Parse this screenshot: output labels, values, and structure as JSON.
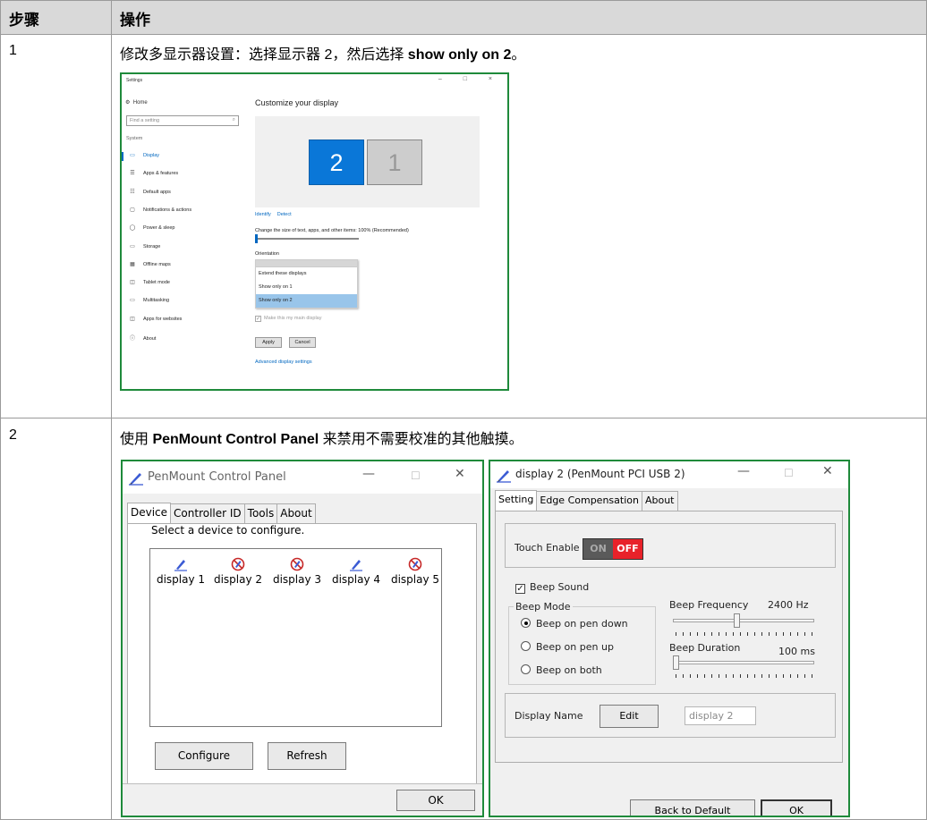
{
  "table": {
    "header": {
      "step_label": "步骤",
      "action_label": "操作"
    },
    "rows": [
      {
        "step": "1",
        "instruction_prefix": "修改多显示器设置：选择显示器 2，然后选择 ",
        "instruction_bold": "show only on 2",
        "instruction_suffix": "。"
      },
      {
        "step": "2",
        "instruction_prefix": "使用 ",
        "instruction_bold": "PenMount Control Panel",
        "instruction_suffix": " 来禁用不需要校准的其他触摸。"
      }
    ]
  },
  "settings_window": {
    "title": "Settings",
    "controls": "–  □  ×",
    "home": "Home",
    "search_placeholder": "Find a setting",
    "section": "System",
    "nav_items": [
      {
        "label": "Display",
        "icon": "monitor-icon"
      },
      {
        "label": "Apps & features",
        "icon": "list-icon"
      },
      {
        "label": "Default apps",
        "icon": "default-apps-icon"
      },
      {
        "label": "Notifications & actions",
        "icon": "notification-icon"
      },
      {
        "label": "Power & sleep",
        "icon": "power-icon"
      },
      {
        "label": "Storage",
        "icon": "storage-icon"
      },
      {
        "label": "Offline maps",
        "icon": "map-icon"
      },
      {
        "label": "Tablet mode",
        "icon": "tablet-icon"
      },
      {
        "label": "Multitasking",
        "icon": "multitasking-icon"
      },
      {
        "label": "Apps for websites",
        "icon": "web-apps-icon"
      },
      {
        "label": "About",
        "icon": "info-icon"
      }
    ],
    "heading": "Customize your display",
    "monitor_2": "2",
    "monitor_1": "1",
    "identify": "Identify",
    "detect": "Detect",
    "scale_text": "Change the size of text, apps, and other items: 100% (Recommended)",
    "orientation_label": "Orientation",
    "dropdown_options": [
      "Extend these displays",
      "Show only on 1",
      "Show only on 2"
    ],
    "main_display_check": "Make this my main display",
    "apply": "Apply",
    "cancel": "Cancel",
    "advanced": "Advanced display settings"
  },
  "penmount_panel": {
    "title": "PenMount Control Panel",
    "tabs": [
      "Device",
      "Controller ID",
      "Tools",
      "About"
    ],
    "select_prompt": "Select a device to configure.",
    "devices": [
      {
        "label": "display 1",
        "icon": "pen-icon"
      },
      {
        "label": "display 2",
        "icon": "disabled-pen-icon"
      },
      {
        "label": "display 3",
        "icon": "disabled-pen-icon"
      },
      {
        "label": "display 4",
        "icon": "pen-icon"
      },
      {
        "label": "display 5",
        "icon": "disabled-pen-icon"
      }
    ],
    "configure": "Configure",
    "refresh": "Refresh",
    "ok": "OK"
  },
  "display2_window": {
    "title": "display 2 (PenMount PCI USB 2)",
    "tabs": [
      "Setting",
      "Edge Compensation",
      "About"
    ],
    "touch_enable": "Touch Enable",
    "toggle_on": "ON",
    "toggle_off": "OFF",
    "beep_sound": "Beep Sound",
    "beep_sound_checked": true,
    "beep_mode": "Beep Mode",
    "beep_options": [
      "Beep on pen down",
      "Beep on pen up",
      "Beep on both"
    ],
    "beep_selected": 0,
    "beep_frequency_label": "Beep Frequency",
    "beep_frequency_value": "2400 Hz",
    "beep_frequency_level": 0.45,
    "beep_duration_label": "Beep Duration",
    "beep_duration_value": "100  ms",
    "beep_duration_level": 0.0,
    "display_name_label": "Display Name",
    "edit": "Edit",
    "display_name_value": "display 2",
    "back_to_default": "Back to Default",
    "ok": "OK"
  }
}
